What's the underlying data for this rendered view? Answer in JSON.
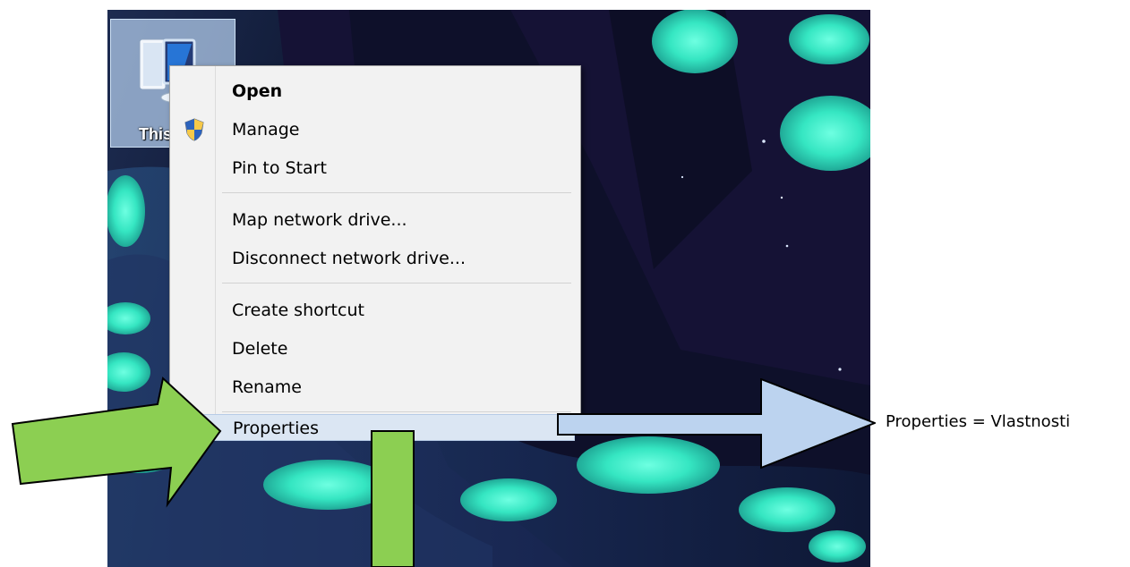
{
  "desktop": {
    "icon_name": "computer-icon",
    "label": "This"
  },
  "context_menu": {
    "items": [
      {
        "label": "Open",
        "default": true,
        "icon": ""
      },
      {
        "label": "Manage",
        "default": false,
        "icon": "shield-icon"
      },
      {
        "label": "Pin to Start",
        "default": false,
        "icon": ""
      },
      {
        "label": "Map network drive...",
        "default": false,
        "icon": ""
      },
      {
        "label": "Disconnect network drive...",
        "default": false,
        "icon": ""
      },
      {
        "label": "Create shortcut",
        "default": false,
        "icon": ""
      },
      {
        "label": "Delete",
        "default": false,
        "icon": ""
      },
      {
        "label": "Rename",
        "default": false,
        "icon": ""
      },
      {
        "label": "Properties",
        "default": false,
        "icon": ""
      }
    ],
    "selected_item": "Properties"
  },
  "annotations": {
    "label": "Properties = Vlastnosti",
    "left_arrow_color": "#8ccf52",
    "bottom_arrow_color": "#8ccf52",
    "right_arrow_color": "#bcd3ef"
  },
  "colors": {
    "selected_background": "#dbe6f3",
    "menu_background": "#f2f2f2",
    "wallpaper_glow": "#35e6c2",
    "wallpaper_dark": "#120f30"
  }
}
